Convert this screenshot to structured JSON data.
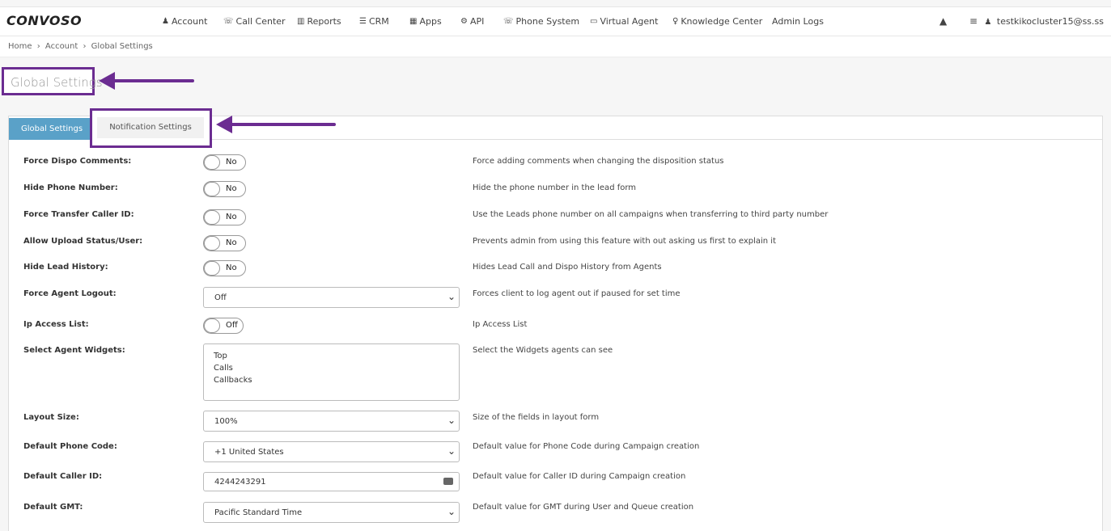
{
  "brand": "CONVOSO",
  "nav": {
    "items": [
      {
        "label": "Account",
        "icon": "user-icon",
        "glyph": "♟"
      },
      {
        "label": "Call Center",
        "icon": "phone-icon",
        "glyph": "☏"
      },
      {
        "label": "Reports",
        "icon": "bar-chart-icon",
        "glyph": "▥"
      },
      {
        "label": "CRM",
        "icon": "list-icon",
        "glyph": "☰"
      },
      {
        "label": "Apps",
        "icon": "grid-icon",
        "glyph": "▦"
      },
      {
        "label": "API",
        "icon": "gear-icon",
        "glyph": "⚙"
      },
      {
        "label": "Phone System",
        "icon": "phone-icon",
        "glyph": "☏"
      },
      {
        "label": "Virtual Agent",
        "icon": "monitor-icon",
        "glyph": "▭"
      },
      {
        "label": "Knowledge Center",
        "icon": "lightbulb-icon",
        "glyph": "♀"
      },
      {
        "label": "Admin Logs",
        "icon": "",
        "glyph": ""
      }
    ],
    "user_email": "testkikocluster15@ss.ss"
  },
  "breadcrumb": [
    "Home",
    "Account",
    "Global Settings"
  ],
  "breadcrumb_sep": "›",
  "page_title": "Global Settings",
  "tabs": {
    "active": "Global Settings",
    "other": "Notification Settings"
  },
  "accent_color": "#5aa1c8",
  "highlight_color": "#6b2c91",
  "settings": {
    "force_dispo": {
      "label": "Force Dispo Comments:",
      "value": "No",
      "desc": "Force adding comments when changing the disposition status"
    },
    "hide_phone": {
      "label": "Hide Phone Number:",
      "value": "No",
      "desc": "Hide the phone number in the lead form"
    },
    "force_transfer": {
      "label": "Force Transfer Caller ID:",
      "value": "No",
      "desc": "Use the Leads phone number on all campaigns when transferring to third party number"
    },
    "allow_upload": {
      "label": "Allow Upload Status/User:",
      "value": "No",
      "desc": "Prevents admin from using this feature with out asking us first to explain it"
    },
    "hide_lead_history": {
      "label": "Hide Lead History:",
      "value": "No",
      "desc": "Hides Lead Call and Dispo History from Agents"
    },
    "force_logout": {
      "label": "Force Agent Logout:",
      "value": "Off",
      "desc": "Forces client to log agent out if paused for set time"
    },
    "ip_access": {
      "label": "Ip Access List:",
      "value": "Off",
      "desc": "Ip Access List"
    },
    "agent_widgets": {
      "label": "Select Agent Widgets:",
      "options": [
        "Top",
        "Calls",
        "Callbacks"
      ],
      "desc": "Select the Widgets agents can see"
    },
    "layout_size": {
      "label": "Layout Size:",
      "value": "100%",
      "desc": "Size of the fields in layout form"
    },
    "phone_code": {
      "label": "Default Phone Code:",
      "value": "+1 United States",
      "desc": "Default value for Phone Code during Campaign creation"
    },
    "caller_id": {
      "label": "Default Caller ID:",
      "value": "4244243291",
      "desc": "Default value for Caller ID during Campaign creation"
    },
    "gmt": {
      "label": "Default GMT:",
      "value": "Pacific Standard Time",
      "desc": "Default value for GMT during User and Queue creation"
    }
  }
}
